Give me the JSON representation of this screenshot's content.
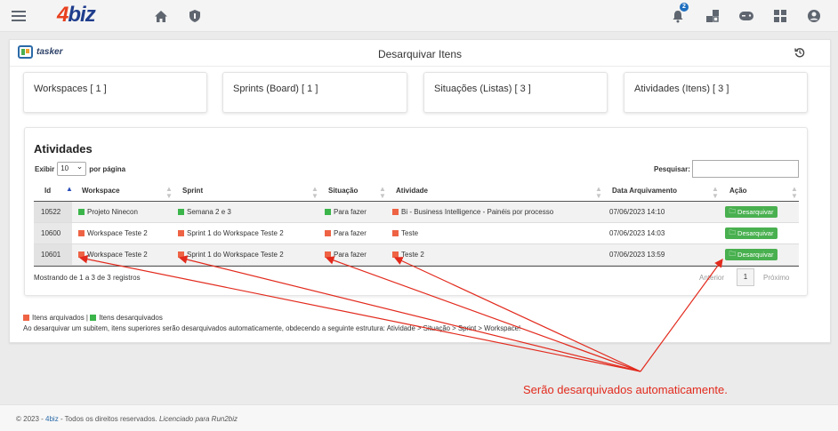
{
  "brand": {
    "logo_num": "4",
    "logo_text": "biz"
  },
  "header": {
    "notification_count": "2"
  },
  "panel": {
    "app_name": "tasker",
    "title": "Desarquivar Itens"
  },
  "cards": [
    {
      "label": "Workspaces [ 1 ]"
    },
    {
      "label": "Sprints (Board) [ 1 ]"
    },
    {
      "label": "Situações (Listas) [ 3 ]"
    },
    {
      "label": "Atividades (Itens) [ 3 ]"
    }
  ],
  "table": {
    "title": "Atividades",
    "show_label": "Exibir",
    "page_size": "10",
    "per_page_label": "por página",
    "search_label": "Pesquisar:",
    "search_value": "",
    "columns": [
      "Id",
      "Workspace",
      "Sprint",
      "Situação",
      "Atividade",
      "Data Arquivamento",
      "Ação"
    ],
    "rows": [
      {
        "id": "10522",
        "workspace": "Projeto Ninecon",
        "workspace_status": "green",
        "sprint": "Semana 2 e 3",
        "sprint_status": "green",
        "situacao": "Para fazer",
        "situacao_status": "green",
        "atividade": "Bi - Business Intelligence - Painéis por processo",
        "atividade_status": "red",
        "data": "07/06/2023 14:10",
        "action": "Desarquivar"
      },
      {
        "id": "10600",
        "workspace": "Workspace Teste 2",
        "workspace_status": "red",
        "sprint": "Sprint 1 do Workspace Teste 2",
        "sprint_status": "red",
        "situacao": "Para fazer",
        "situacao_status": "red",
        "atividade": "Teste",
        "atividade_status": "red",
        "data": "07/06/2023 14:03",
        "action": "Desarquivar"
      },
      {
        "id": "10601",
        "workspace": "Workspace Teste 2",
        "workspace_status": "red",
        "sprint": "Sprint 1 do Workspace Teste 2",
        "sprint_status": "red",
        "situacao": "Para fazer",
        "situacao_status": "red",
        "atividade": "Teste 2",
        "atividade_status": "red",
        "data": "07/06/2023 13:59",
        "action": "Desarquivar"
      }
    ],
    "info": "Mostrando de 1 a 3 de 3 registros",
    "pagination": {
      "prev": "Anterior",
      "current": "1",
      "next": "Próximo"
    }
  },
  "legend": {
    "archived": "Itens arquivados",
    "separator": " | ",
    "unarchived": "Itens desarquivados"
  },
  "note": "Ao desarquivar um subitem, itens superiores serão desarquivados automaticamente, obdecendo a seguinte estrutura: Atividade > Situação > Sprint > Workspace!",
  "annotation": "Serão desarquivados automaticamente.",
  "footer": {
    "prefix": "© 2023 - ",
    "brand": "4biz",
    "middle": " - Todos os direitos reservados. ",
    "license": "Licenciado para Run2biz"
  },
  "colors": {
    "archived": "#ee6344",
    "unarchived": "#3bb54a",
    "annotation": "#e22a1d",
    "button": "#49b04f"
  }
}
